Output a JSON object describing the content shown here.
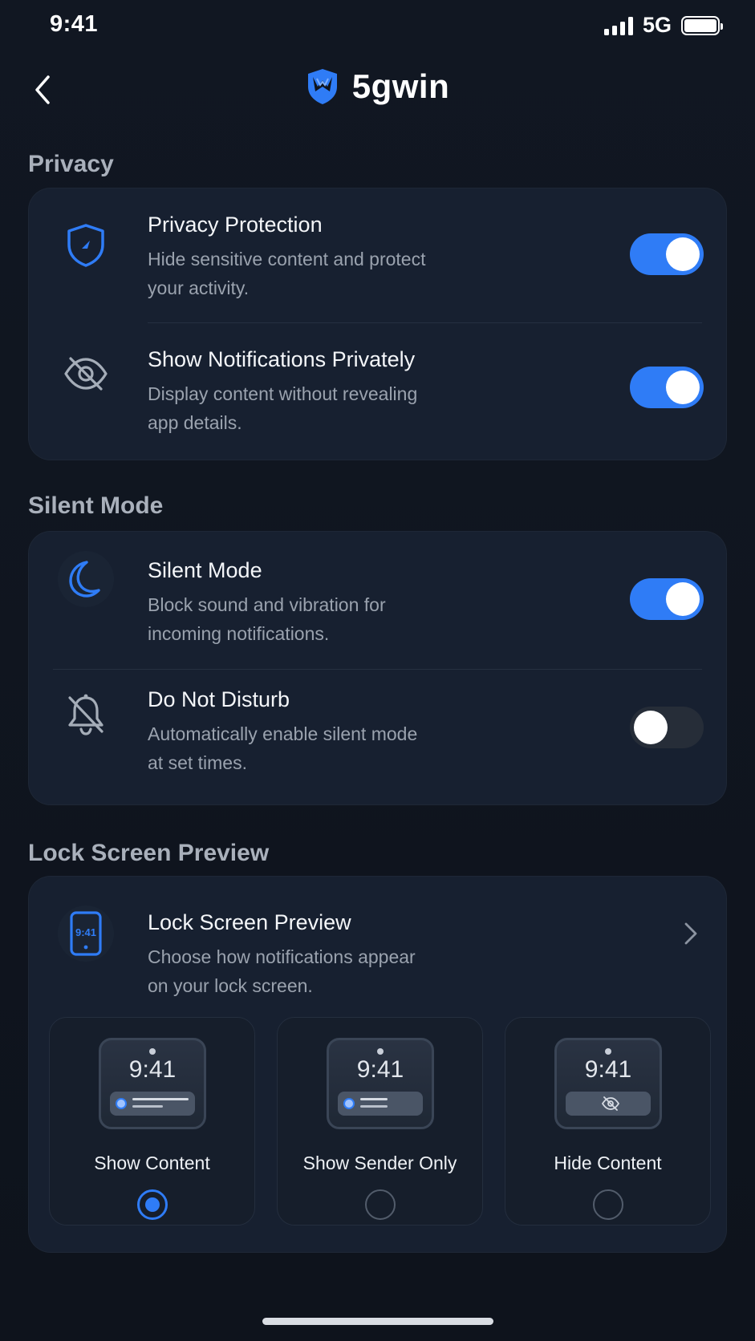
{
  "status_bar": {
    "time": "9:41",
    "network": "5G"
  },
  "header": {
    "app_name": "5gwin"
  },
  "privacy": {
    "section_title": "Privacy",
    "items": [
      {
        "title": "Privacy Protection",
        "desc_line1": "Hide sensitive content and protect",
        "desc_line2": "your activity.",
        "enabled": true,
        "icon": "shield-icon"
      },
      {
        "title": "Show Notifications Privately",
        "desc_line1": "Display content without revealing",
        "desc_line2": "app details.",
        "enabled": true,
        "icon": "eye-off-icon"
      }
    ]
  },
  "silent": {
    "section_title": "Silent Mode",
    "items": [
      {
        "title": "Silent Mode",
        "desc_line1": "Block sound and vibration for",
        "desc_line2": "incoming notifications.",
        "enabled": true,
        "icon": "moon-icon"
      },
      {
        "title": "Do Not Disturb",
        "desc_line1": "Automatically enable silent mode",
        "desc_line2": "at set times.",
        "enabled": false,
        "icon": "bell-off-icon"
      }
    ]
  },
  "lock_screen": {
    "section_title": "Lock Screen Preview",
    "title": "Lock Screen Preview",
    "desc_line1": "Choose how notifications appear",
    "desc_line2": "on your lock screen.",
    "phone_icon_text": "9:41",
    "options": [
      {
        "label": "Show Content",
        "time": "9:41",
        "selected": true
      },
      {
        "label": "Show Sender Only",
        "time": "9:41",
        "selected": false
      },
      {
        "label": "Hide Content",
        "time": "9:41",
        "selected": false
      }
    ]
  },
  "colors": {
    "accent": "#2f7cf6",
    "background": "#0f141d",
    "card": "#172030"
  }
}
